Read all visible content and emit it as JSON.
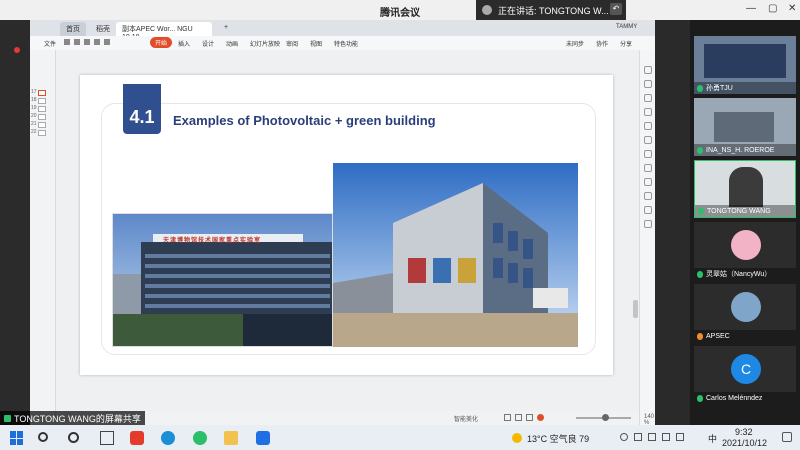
{
  "meeting": {
    "title": "腾讯会议",
    "speaking_label": "正在讲话: TONGTONG W...",
    "record_label": "",
    "screen_share_label": "TONGTONG WANG的屏幕共享"
  },
  "wps": {
    "tabs": [
      {
        "label": "首页"
      },
      {
        "label": "稻壳"
      },
      {
        "label": "副本APEC Wor... NGU 10.10"
      },
      {
        "label": "+"
      }
    ],
    "user": "TAMMY",
    "menu": [
      {
        "label": "文件"
      },
      {
        "label": "开始"
      },
      {
        "label": "插入"
      },
      {
        "label": "设计"
      },
      {
        "label": "动画"
      },
      {
        "label": "幻灯片放映"
      },
      {
        "label": "审阅"
      },
      {
        "label": "视图"
      },
      {
        "label": "特色功能"
      }
    ],
    "menu_right": {
      "unsaved": "未同步",
      "collab": "协作",
      "share": "分享"
    },
    "thumb_numbers": [
      "17",
      "18",
      "19",
      "20",
      "21",
      "22"
    ],
    "status": {
      "zoom": "140 %",
      "beautify": "智能美化"
    }
  },
  "slide": {
    "number": "4.1",
    "title": "Examples of Photovoltaic + green building",
    "left_photo_sign": "天津博物馆技术国家重点实验室"
  },
  "participants": [
    {
      "name": "孙勇TJU",
      "kind": "video"
    },
    {
      "name": "INA_NS_H. ROEROE",
      "kind": "video"
    },
    {
      "name": "TONGTONG WANG",
      "kind": "video"
    },
    {
      "name": "灵翠姑（NancyWu）",
      "kind": "avatar"
    },
    {
      "name": "APSEC",
      "kind": "avatar"
    },
    {
      "name": "Carlos Melénndez",
      "kind": "letter",
      "letter": "C"
    }
  ],
  "taskbar": {
    "weather": "13°C 空气良 79",
    "ime": "中",
    "time": "9:32",
    "date": "2021/10/12"
  },
  "colors": {
    "slide_number_bg": "#2f4f8f",
    "slide_title": "#2a3f7a",
    "start_tab": "#e14d2a",
    "carlos_avatar": "#1e88e5"
  }
}
